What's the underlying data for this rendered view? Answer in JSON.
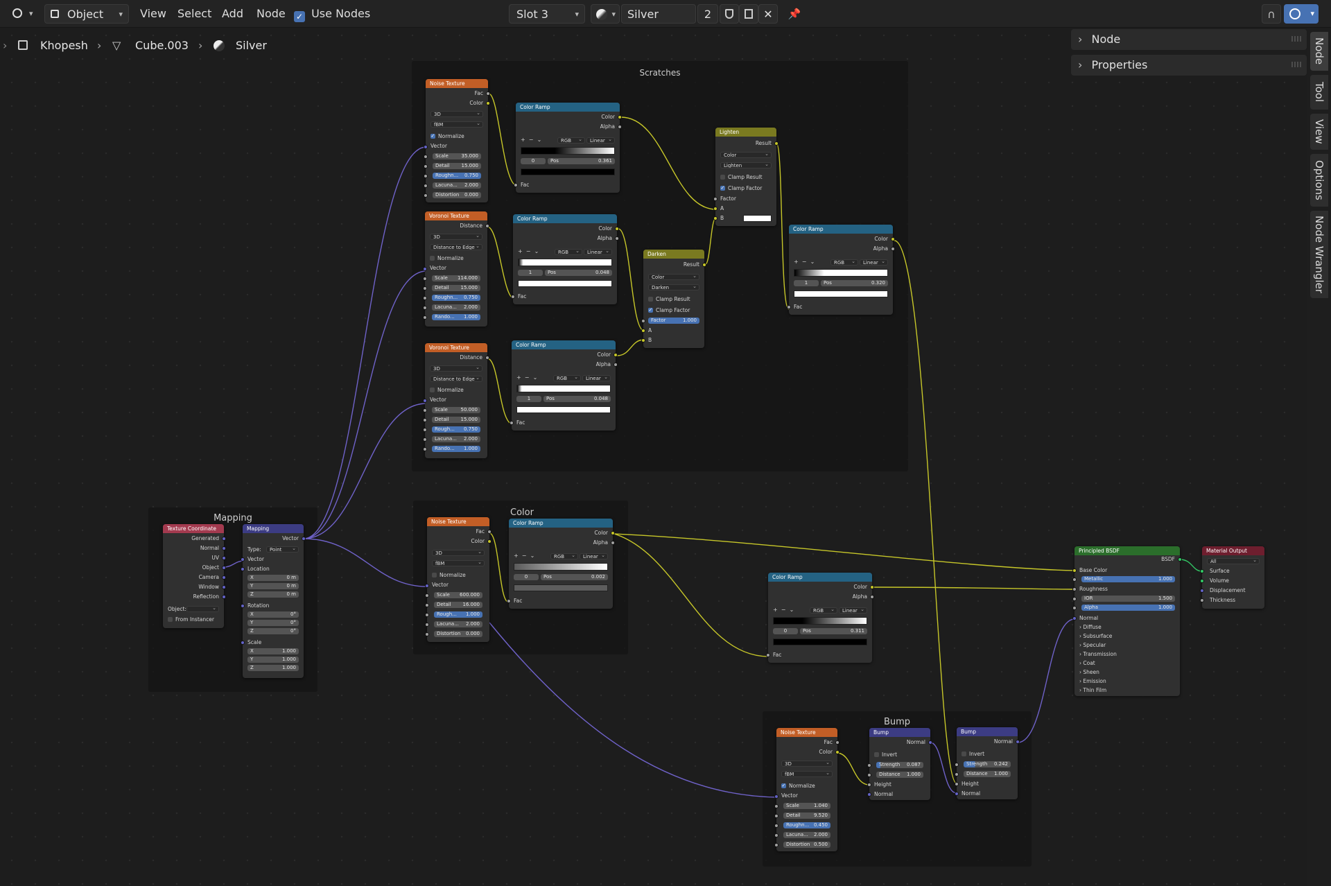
{
  "header": {
    "mode": "Object",
    "menus": [
      "View",
      "Select",
      "Add",
      "Node"
    ],
    "use_nodes_label": "Use Nodes",
    "slot": "Slot 3",
    "material": "Silver",
    "users": "2"
  },
  "breadcrumb": {
    "object": "Khopesh",
    "mesh": "Cube.003",
    "material": "Silver"
  },
  "side_panel": {
    "node": "Node",
    "properties": "Properties"
  },
  "tabs": [
    "Node",
    "Tool",
    "View",
    "Options",
    "Node Wrangler"
  ],
  "frames": {
    "scratches": "Scratches",
    "mapping": "Mapping",
    "color": "Color",
    "bump": "Bump"
  },
  "nodes": {
    "noise1": {
      "title": "Noise Texture",
      "fac": "Fac",
      "color": "Color",
      "dim": "3D",
      "type": "fBM",
      "normalize": "Normalize",
      "vector": "Vector",
      "scale_l": "Scale",
      "scale_v": "35.000",
      "detail_l": "Detail",
      "detail_v": "15.000",
      "rough_l": "Roughn...",
      "rough_v": "0.750",
      "lac_l": "Lacuna...",
      "lac_v": "2.000",
      "dist_l": "Distortion",
      "dist_v": "0.000"
    },
    "voronoi1": {
      "title": "Voronoi Texture",
      "distance": "Distance",
      "dim": "3D",
      "feature": "Distance to Edge",
      "normalize": "Normalize",
      "vector": "Vector",
      "scale_l": "Scale",
      "scale_v": "114.000",
      "detail_l": "Detail",
      "detail_v": "15.000",
      "rough_l": "Roughn...",
      "rough_v": "0.750",
      "lac_l": "Lacuna...",
      "lac_v": "2.000",
      "rand_l": "Rando...",
      "rand_v": "1.000"
    },
    "voronoi2": {
      "title": "Voronoi Texture",
      "distance": "Distance",
      "dim": "3D",
      "feature": "Distance to Edge",
      "normalize": "Normalize",
      "vector": "Vector",
      "scale_l": "Scale",
      "scale_v": "50.000",
      "detail_l": "Detail",
      "detail_v": "15.000",
      "rough_l": "Rough...",
      "rough_v": "0.750",
      "lac_l": "Lacuna...",
      "lac_v": "2.000",
      "rand_l": "Rando...",
      "rand_v": "1.000"
    },
    "ramp1": {
      "title": "Color Ramp",
      "color": "Color",
      "alpha": "Alpha",
      "mode": "RGB",
      "interp": "Linear",
      "idx": "0",
      "pos_l": "Pos",
      "pos_v": "0.361",
      "fac": "Fac"
    },
    "ramp2": {
      "title": "Color Ramp",
      "color": "Color",
      "alpha": "Alpha",
      "mode": "RGB",
      "interp": "Linear",
      "idx": "1",
      "pos_l": "Pos",
      "pos_v": "0.048",
      "fac": "Fac"
    },
    "ramp3": {
      "title": "Color Ramp",
      "color": "Color",
      "alpha": "Alpha",
      "mode": "RGB",
      "interp": "Linear",
      "idx": "1",
      "pos_l": "Pos",
      "pos_v": "0.048",
      "fac": "Fac"
    },
    "ramp4": {
      "title": "Color Ramp",
      "color": "Color",
      "alpha": "Alpha",
      "mode": "RGB",
      "interp": "Linear",
      "idx": "1",
      "pos_l": "Pos",
      "pos_v": "0.320",
      "fac": "Fac"
    },
    "ramp5": {
      "title": "Color Ramp",
      "color": "Color",
      "alpha": "Alpha",
      "mode": "RGB",
      "interp": "Linear",
      "idx": "0",
      "pos_l": "Pos",
      "pos_v": "0.002",
      "fac": "Fac"
    },
    "ramp6": {
      "title": "Color Ramp",
      "color": "Color",
      "alpha": "Alpha",
      "mode": "RGB",
      "interp": "Linear",
      "idx": "0",
      "pos_l": "Pos",
      "pos_v": "0.311",
      "fac": "Fac"
    },
    "lighten": {
      "title": "Lighten",
      "result": "Result",
      "type": "Color",
      "blend": "Lighten",
      "clamp_result": "Clamp Result",
      "clamp_factor": "Clamp Factor",
      "factor": "Factor",
      "a": "A",
      "b": "B"
    },
    "darken": {
      "title": "Darken",
      "result": "Result",
      "type": "Color",
      "blend": "Darken",
      "clamp_result": "Clamp Result",
      "clamp_factor": "Clamp Factor",
      "factor_l": "Factor",
      "factor_v": "1.000",
      "a": "A",
      "b": "B"
    },
    "texcoord": {
      "title": "Texture Coordinate",
      "outputs": [
        "Generated",
        "Normal",
        "UV",
        "Object",
        "Camera",
        "Window",
        "Reflection"
      ],
      "object_l": "Object:",
      "from_instancer": "From Instancer"
    },
    "mapping": {
      "title": "Mapping",
      "vector_out": "Vector",
      "type_l": "Type:",
      "type_v": "Point",
      "vector": "Vector",
      "location": "Location",
      "loc": [
        [
          "X",
          "0 m"
        ],
        [
          "Y",
          "0 m"
        ],
        [
          "Z",
          "0 m"
        ]
      ],
      "rotation": "Rotation",
      "rot": [
        [
          "X",
          "0°"
        ],
        [
          "Y",
          "0°"
        ],
        [
          "Z",
          "0°"
        ]
      ],
      "scale": "Scale",
      "scl": [
        [
          "X",
          "1.000"
        ],
        [
          "Y",
          "1.000"
        ],
        [
          "Z",
          "1.000"
        ]
      ]
    },
    "noise2": {
      "title": "Noise Texture",
      "fac": "Fac",
      "color": "Color",
      "dim": "3D",
      "type": "fBM",
      "normalize": "Normalize",
      "vector": "Vector",
      "scale_l": "Scale",
      "scale_v": "600.000",
      "detail_l": "Detail",
      "detail_v": "16.000",
      "rough_l": "Rough...",
      "rough_v": "1.000",
      "lac_l": "Lacuna...",
      "lac_v": "2.000",
      "dist_l": "Distortion",
      "dist_v": "0.000"
    },
    "noise3": {
      "title": "Noise Texture",
      "fac": "Fac",
      "color": "Color",
      "dim": "3D",
      "type": "fBM",
      "normalize": "Normalize",
      "vector": "Vector",
      "scale_l": "Scale",
      "scale_v": "1.040",
      "detail_l": "Detail",
      "detail_v": "9.520",
      "rough_l": "Roughn...",
      "rough_v": "0.450",
      "lac_l": "Lacuna...",
      "lac_v": "2.000",
      "dist_l": "Distortion",
      "dist_v": "0.500"
    },
    "bump1": {
      "title": "Bump",
      "normal_out": "Normal",
      "invert": "Invert",
      "strength_l": "Strength",
      "strength_v": "0.087",
      "distance_l": "Distance",
      "distance_v": "1.000",
      "height": "Height",
      "normal": "Normal"
    },
    "bump2": {
      "title": "Bump",
      "normal_out": "Normal",
      "invert": "Invert",
      "strength_l": "Strength",
      "strength_v": "0.242",
      "distance_l": "Distance",
      "distance_v": "1.000",
      "height": "Height",
      "normal": "Normal"
    },
    "bsdf": {
      "title": "Principled BSDF",
      "bsdf": "BSDF",
      "base_color": "Base Color",
      "metallic_l": "Metallic",
      "metallic_v": "1.000",
      "roughness": "Roughness",
      "ior_l": "IOR",
      "ior_v": "1.500",
      "alpha_l": "Alpha",
      "alpha_v": "1.000",
      "normal": "Normal",
      "panels": [
        "Diffuse",
        "Subsurface",
        "Specular",
        "Transmission",
        "Coat",
        "Sheen",
        "Emission",
        "Thin Film"
      ]
    },
    "output": {
      "title": "Material Output",
      "target": "All",
      "inputs": [
        "Surface",
        "Volume",
        "Displacement",
        "Thickness"
      ]
    }
  },
  "colors": {
    "texture_header": "#c25e26",
    "converter_header": "#246283",
    "mix_header": "#7a7a20",
    "input_header": "#a33a4f",
    "vector_header": "#3c3c83",
    "shader_header": "#2b6e2b",
    "output_header": "#6e1e2e"
  }
}
